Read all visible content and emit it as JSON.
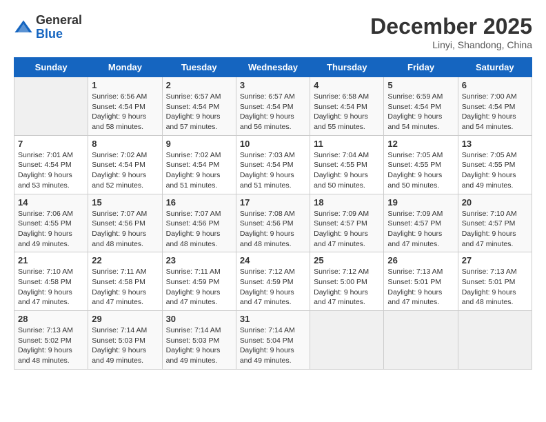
{
  "header": {
    "logo_general": "General",
    "logo_blue": "Blue",
    "month_title": "December 2025",
    "location": "Linyi, Shandong, China"
  },
  "days_of_week": [
    "Sunday",
    "Monday",
    "Tuesday",
    "Wednesday",
    "Thursday",
    "Friday",
    "Saturday"
  ],
  "weeks": [
    [
      {
        "day": "",
        "sunrise": "",
        "sunset": "",
        "daylight": ""
      },
      {
        "day": "1",
        "sunrise": "Sunrise: 6:56 AM",
        "sunset": "Sunset: 4:54 PM",
        "daylight": "Daylight: 9 hours and 58 minutes."
      },
      {
        "day": "2",
        "sunrise": "Sunrise: 6:57 AM",
        "sunset": "Sunset: 4:54 PM",
        "daylight": "Daylight: 9 hours and 57 minutes."
      },
      {
        "day": "3",
        "sunrise": "Sunrise: 6:57 AM",
        "sunset": "Sunset: 4:54 PM",
        "daylight": "Daylight: 9 hours and 56 minutes."
      },
      {
        "day": "4",
        "sunrise": "Sunrise: 6:58 AM",
        "sunset": "Sunset: 4:54 PM",
        "daylight": "Daylight: 9 hours and 55 minutes."
      },
      {
        "day": "5",
        "sunrise": "Sunrise: 6:59 AM",
        "sunset": "Sunset: 4:54 PM",
        "daylight": "Daylight: 9 hours and 54 minutes."
      },
      {
        "day": "6",
        "sunrise": "Sunrise: 7:00 AM",
        "sunset": "Sunset: 4:54 PM",
        "daylight": "Daylight: 9 hours and 54 minutes."
      }
    ],
    [
      {
        "day": "7",
        "sunrise": "Sunrise: 7:01 AM",
        "sunset": "Sunset: 4:54 PM",
        "daylight": "Daylight: 9 hours and 53 minutes."
      },
      {
        "day": "8",
        "sunrise": "Sunrise: 7:02 AM",
        "sunset": "Sunset: 4:54 PM",
        "daylight": "Daylight: 9 hours and 52 minutes."
      },
      {
        "day": "9",
        "sunrise": "Sunrise: 7:02 AM",
        "sunset": "Sunset: 4:54 PM",
        "daylight": "Daylight: 9 hours and 51 minutes."
      },
      {
        "day": "10",
        "sunrise": "Sunrise: 7:03 AM",
        "sunset": "Sunset: 4:54 PM",
        "daylight": "Daylight: 9 hours and 51 minutes."
      },
      {
        "day": "11",
        "sunrise": "Sunrise: 7:04 AM",
        "sunset": "Sunset: 4:55 PM",
        "daylight": "Daylight: 9 hours and 50 minutes."
      },
      {
        "day": "12",
        "sunrise": "Sunrise: 7:05 AM",
        "sunset": "Sunset: 4:55 PM",
        "daylight": "Daylight: 9 hours and 50 minutes."
      },
      {
        "day": "13",
        "sunrise": "Sunrise: 7:05 AM",
        "sunset": "Sunset: 4:55 PM",
        "daylight": "Daylight: 9 hours and 49 minutes."
      }
    ],
    [
      {
        "day": "14",
        "sunrise": "Sunrise: 7:06 AM",
        "sunset": "Sunset: 4:55 PM",
        "daylight": "Daylight: 9 hours and 49 minutes."
      },
      {
        "day": "15",
        "sunrise": "Sunrise: 7:07 AM",
        "sunset": "Sunset: 4:56 PM",
        "daylight": "Daylight: 9 hours and 48 minutes."
      },
      {
        "day": "16",
        "sunrise": "Sunrise: 7:07 AM",
        "sunset": "Sunset: 4:56 PM",
        "daylight": "Daylight: 9 hours and 48 minutes."
      },
      {
        "day": "17",
        "sunrise": "Sunrise: 7:08 AM",
        "sunset": "Sunset: 4:56 PM",
        "daylight": "Daylight: 9 hours and 48 minutes."
      },
      {
        "day": "18",
        "sunrise": "Sunrise: 7:09 AM",
        "sunset": "Sunset: 4:57 PM",
        "daylight": "Daylight: 9 hours and 47 minutes."
      },
      {
        "day": "19",
        "sunrise": "Sunrise: 7:09 AM",
        "sunset": "Sunset: 4:57 PM",
        "daylight": "Daylight: 9 hours and 47 minutes."
      },
      {
        "day": "20",
        "sunrise": "Sunrise: 7:10 AM",
        "sunset": "Sunset: 4:57 PM",
        "daylight": "Daylight: 9 hours and 47 minutes."
      }
    ],
    [
      {
        "day": "21",
        "sunrise": "Sunrise: 7:10 AM",
        "sunset": "Sunset: 4:58 PM",
        "daylight": "Daylight: 9 hours and 47 minutes."
      },
      {
        "day": "22",
        "sunrise": "Sunrise: 7:11 AM",
        "sunset": "Sunset: 4:58 PM",
        "daylight": "Daylight: 9 hours and 47 minutes."
      },
      {
        "day": "23",
        "sunrise": "Sunrise: 7:11 AM",
        "sunset": "Sunset: 4:59 PM",
        "daylight": "Daylight: 9 hours and 47 minutes."
      },
      {
        "day": "24",
        "sunrise": "Sunrise: 7:12 AM",
        "sunset": "Sunset: 4:59 PM",
        "daylight": "Daylight: 9 hours and 47 minutes."
      },
      {
        "day": "25",
        "sunrise": "Sunrise: 7:12 AM",
        "sunset": "Sunset: 5:00 PM",
        "daylight": "Daylight: 9 hours and 47 minutes."
      },
      {
        "day": "26",
        "sunrise": "Sunrise: 7:13 AM",
        "sunset": "Sunset: 5:01 PM",
        "daylight": "Daylight: 9 hours and 47 minutes."
      },
      {
        "day": "27",
        "sunrise": "Sunrise: 7:13 AM",
        "sunset": "Sunset: 5:01 PM",
        "daylight": "Daylight: 9 hours and 48 minutes."
      }
    ],
    [
      {
        "day": "28",
        "sunrise": "Sunrise: 7:13 AM",
        "sunset": "Sunset: 5:02 PM",
        "daylight": "Daylight: 9 hours and 48 minutes."
      },
      {
        "day": "29",
        "sunrise": "Sunrise: 7:14 AM",
        "sunset": "Sunset: 5:03 PM",
        "daylight": "Daylight: 9 hours and 49 minutes."
      },
      {
        "day": "30",
        "sunrise": "Sunrise: 7:14 AM",
        "sunset": "Sunset: 5:03 PM",
        "daylight": "Daylight: 9 hours and 49 minutes."
      },
      {
        "day": "31",
        "sunrise": "Sunrise: 7:14 AM",
        "sunset": "Sunset: 5:04 PM",
        "daylight": "Daylight: 9 hours and 49 minutes."
      },
      {
        "day": "",
        "sunrise": "",
        "sunset": "",
        "daylight": ""
      },
      {
        "day": "",
        "sunrise": "",
        "sunset": "",
        "daylight": ""
      },
      {
        "day": "",
        "sunrise": "",
        "sunset": "",
        "daylight": ""
      }
    ]
  ]
}
